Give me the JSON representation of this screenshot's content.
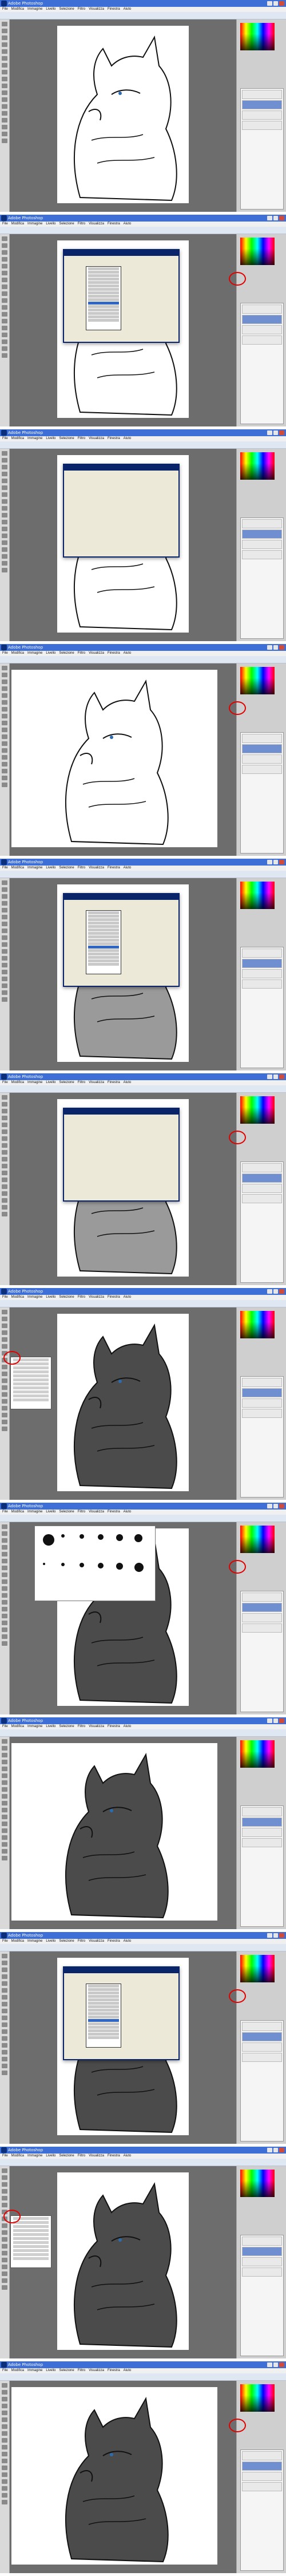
{
  "app": {
    "window_title": "Adobe Photoshop",
    "menus": [
      "File",
      "Modifica",
      "Immagine",
      "Livello",
      "Selezione",
      "Filtro",
      "Visualizza",
      "Finestra",
      "Aiuto"
    ]
  },
  "panels": [
    {
      "state": "lineart",
      "canvas": "white"
    },
    {
      "state": "layer-style-dialog-blend-menu",
      "canvas": "white"
    },
    {
      "state": "layer-style-dialog",
      "canvas": "white"
    },
    {
      "state": "zoom-eye-brush",
      "canvas": "white"
    },
    {
      "state": "blend-mode-dropdown",
      "canvas": "gray-fill"
    },
    {
      "state": "layer-dialog-opacity",
      "canvas": "gray-fill"
    },
    {
      "state": "shaded-wolf-context-menu",
      "canvas": "dark-fill"
    },
    {
      "state": "brush-presets",
      "canvas": "dark-fill"
    },
    {
      "state": "zoom-detail",
      "canvas": "dark-fill"
    },
    {
      "state": "blend-mode-dropdown-2",
      "canvas": "dark-fill"
    },
    {
      "state": "context-menu-2",
      "canvas": "dark-fill"
    },
    {
      "state": "final",
      "canvas": "dark-fill"
    }
  ],
  "colors": {
    "title_bar": "#3d6fd6",
    "workspace": "#6d6d6d",
    "highlight": "#e00000",
    "selected_layer": "#6f8fd0"
  },
  "icons": [
    "photoshop-logo-icon",
    "minimize-icon",
    "maximize-icon",
    "close-icon",
    "brush-tool-icon",
    "eyedropper-icon"
  ]
}
